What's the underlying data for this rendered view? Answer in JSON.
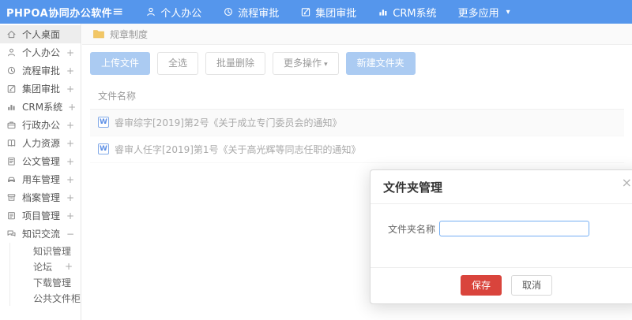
{
  "colors": {
    "navbar_blue": "#5596ec",
    "primary_light_button": "#abcbf2",
    "danger_red": "#d9443c",
    "folder_yellow": "#f2c766"
  },
  "icons": {
    "hamburger": "≡",
    "caret_down": "▾",
    "close": "×",
    "word_badge": "W"
  },
  "navbar": {
    "logo": "PHPOA协同办公软件",
    "items": [
      {
        "label": "个人办公",
        "icon": "user-icon"
      },
      {
        "label": "流程审批",
        "icon": "history-icon"
      },
      {
        "label": "集团审批",
        "icon": "edit-icon"
      },
      {
        "label": "CRM系统",
        "icon": "bar-chart-icon"
      },
      {
        "label": "更多应用",
        "icon": "caret-down-icon"
      }
    ]
  },
  "sidebar": {
    "items": [
      {
        "label": "个人桌面",
        "icon": "home-icon",
        "active": true,
        "expand": ""
      },
      {
        "label": "个人办公",
        "icon": "user-icon",
        "expand": "+"
      },
      {
        "label": "流程审批",
        "icon": "history-icon",
        "expand": "+"
      },
      {
        "label": "集团审批",
        "icon": "edit-icon",
        "expand": "+"
      },
      {
        "label": "CRM系统",
        "icon": "bar-chart-icon",
        "expand": "+"
      },
      {
        "label": "行政办公",
        "icon": "briefcase-icon",
        "expand": "+"
      },
      {
        "label": "人力资源",
        "icon": "book-icon",
        "expand": "+"
      },
      {
        "label": "公文管理",
        "icon": "document-icon",
        "expand": "+"
      },
      {
        "label": "用车管理",
        "icon": "car-icon",
        "expand": "+"
      },
      {
        "label": "档案管理",
        "icon": "archive-icon",
        "expand": "+"
      },
      {
        "label": "项目管理",
        "icon": "clipboard-icon",
        "expand": "+"
      },
      {
        "label": "知识交流",
        "icon": "chat-icon",
        "expand": "−",
        "expanded": true,
        "children": [
          {
            "label": "知识管理",
            "expand": ""
          },
          {
            "label": "论坛",
            "expand": "+"
          },
          {
            "label": "下载管理",
            "expand": ""
          },
          {
            "label": "公共文件柜",
            "expand": ""
          }
        ]
      }
    ]
  },
  "breadcrumb": {
    "label": "规章制度",
    "icon": "folder-icon"
  },
  "toolbar": {
    "buttons": [
      {
        "label": "上传文件",
        "style": "primary"
      },
      {
        "label": "全选",
        "style": "default"
      },
      {
        "label": "批量删除",
        "style": "default"
      },
      {
        "label": "更多操作",
        "style": "default",
        "has_caret": true
      },
      {
        "label": "新建文件夹",
        "style": "primary"
      }
    ]
  },
  "file_list": {
    "header": "文件名称",
    "rows": [
      {
        "icon": "word-file-icon",
        "name": "睿审综字[2019]第2号《关于成立专门委员会的通知》"
      },
      {
        "icon": "word-file-icon",
        "name": "睿审人任字[2019]第1号《关于高光辉等同志任职的通知》"
      }
    ]
  },
  "modal": {
    "title": "文件夹管理",
    "field_label": "文件夹名称",
    "input_value": "",
    "save_label": "保存",
    "cancel_label": "取消"
  }
}
